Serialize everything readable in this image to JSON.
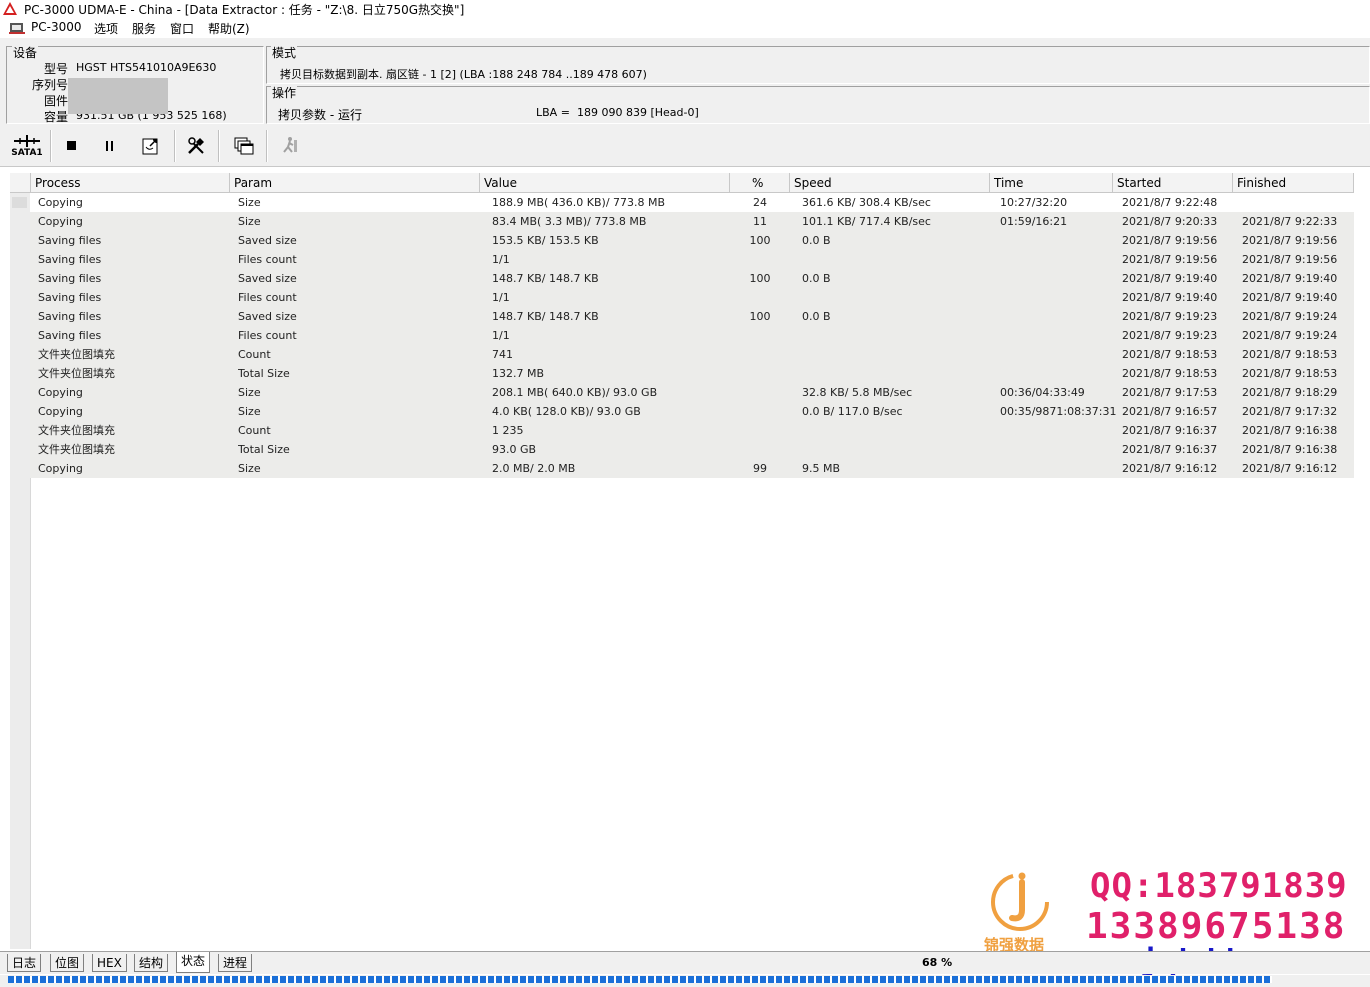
{
  "window": {
    "title": "PC-3000 UDMA-E - China - [Data Extractor : 任务 - \"Z:\\8.        日立750G热交换\"]"
  },
  "menu": {
    "items": [
      "PC-3000",
      "选项",
      "服务",
      "窗口",
      "帮助(Z)"
    ]
  },
  "device": {
    "group_label": "设备",
    "model_label": "型号",
    "model_value": "HGST HTS541010A9E630",
    "serial_label": "序列号",
    "firmware_label": "固件",
    "capacity_label": "容量",
    "capacity_value": "931.51 GB (1 953 525 168)"
  },
  "mode": {
    "group_label": "模式",
    "value": "拷贝目标数据到副本. 扇区链 - 1 [2] (LBA :188 248 784 ..189 478 607)"
  },
  "operation": {
    "group_label": "操作",
    "value": "拷贝参数 - 运行",
    "lba_label": "LBA =",
    "lba_value": "189 090 839  [Head-0]"
  },
  "toolbar": {
    "sata_label": "SATA1"
  },
  "table": {
    "headers": [
      "Process",
      "Param",
      "Value",
      "%",
      "Speed",
      "Time",
      "Started",
      "Finished"
    ],
    "rows": [
      [
        "Copying",
        "Size",
        "188.9 MB( 436.0 KB)/ 773.8 MB",
        "24",
        "361.6 KB/ 308.4 KB/sec",
        "10:27/32:20",
        "2021/8/7 9:22:48",
        ""
      ],
      [
        "Copying",
        "Size",
        "83.4 MB( 3.3 MB)/ 773.8 MB",
        "11",
        "101.1 KB/ 717.4 KB/sec",
        "01:59/16:21",
        "2021/8/7 9:20:33",
        "2021/8/7 9:22:33"
      ],
      [
        "Saving files",
        "Saved size",
        "153.5 KB/ 153.5 KB",
        "100",
        "0.0 B",
        "",
        "2021/8/7 9:19:56",
        "2021/8/7 9:19:56"
      ],
      [
        "Saving files",
        "Files count",
        "1/1",
        "",
        "",
        "",
        "2021/8/7 9:19:56",
        "2021/8/7 9:19:56"
      ],
      [
        "Saving files",
        "Saved size",
        "148.7 KB/ 148.7 KB",
        "100",
        "0.0 B",
        "",
        "2021/8/7 9:19:40",
        "2021/8/7 9:19:40"
      ],
      [
        "Saving files",
        "Files count",
        "1/1",
        "",
        "",
        "",
        "2021/8/7 9:19:40",
        "2021/8/7 9:19:40"
      ],
      [
        "Saving files",
        "Saved size",
        "148.7 KB/ 148.7 KB",
        "100",
        "0.0 B",
        "",
        "2021/8/7 9:19:23",
        "2021/8/7 9:19:24"
      ],
      [
        "Saving files",
        "Files count",
        "1/1",
        "",
        "",
        "",
        "2021/8/7 9:19:23",
        "2021/8/7 9:19:24"
      ],
      [
        "文件夹位图填充",
        "Count",
        "741",
        "",
        "",
        "",
        "2021/8/7 9:18:53",
        "2021/8/7 9:18:53"
      ],
      [
        "文件夹位图填充",
        "Total Size",
        "132.7 MB",
        "",
        "",
        "",
        "2021/8/7 9:18:53",
        "2021/8/7 9:18:53"
      ],
      [
        "Copying",
        "Size",
        "208.1 MB( 640.0 KB)/ 93.0 GB",
        "",
        "32.8 KB/ 5.8 MB/sec",
        "00:36/04:33:49",
        "2021/8/7 9:17:53",
        "2021/8/7 9:18:29"
      ],
      [
        "Copying",
        "Size",
        "4.0 KB( 128.0 KB)/ 93.0 GB",
        "",
        "0.0 B/ 117.0 B/sec",
        "00:35/9871:08:37:31",
        "2021/8/7 9:16:57",
        "2021/8/7 9:17:32"
      ],
      [
        "文件夹位图填充",
        "Count",
        "1 235",
        "",
        "",
        "",
        "2021/8/7 9:16:37",
        "2021/8/7 9:16:38"
      ],
      [
        "文件夹位图填充",
        "Total Size",
        "93.0 GB",
        "",
        "",
        "",
        "2021/8/7 9:16:37",
        "2021/8/7 9:16:38"
      ],
      [
        "Copying",
        "Size",
        "2.0 MB/ 2.0 MB",
        "99",
        "9.5 MB",
        "",
        "2021/8/7 9:16:12",
        "2021/8/7 9:16:12"
      ]
    ]
  },
  "tabs": {
    "items": [
      "日志",
      "位图",
      "HEX",
      "结构",
      "状态",
      "进程"
    ],
    "active": "状态"
  },
  "status": {
    "percent_text": "68 %",
    "progress": 0.68
  },
  "watermark": {
    "qq": "QQ:183791839",
    "phone": "13389675138",
    "url": "www.jqhdd.com",
    "brand": "锦强数据"
  },
  "colors": {
    "watermark_pink": "#e0206a",
    "watermark_blue": "#1818c8",
    "progress_blue": "#1a6fd8"
  }
}
